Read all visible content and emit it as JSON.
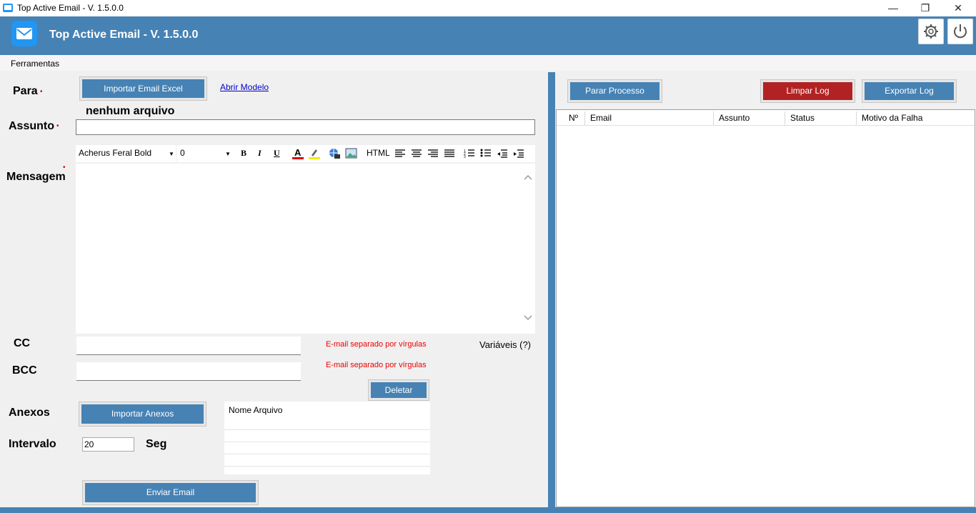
{
  "window": {
    "title": "Top Active Email - V. 1.5.0.0",
    "minimize": "—",
    "restore": "❐",
    "close": "✕"
  },
  "header": {
    "title": "Top Active Email - V. 1.5.0.0",
    "settings_icon": "gear-icon",
    "power_icon": "power-icon"
  },
  "menu": {
    "items": [
      "Ferramentas"
    ]
  },
  "form": {
    "para_label": "Para",
    "import_excel": "Importar Email Excel",
    "open_model": "Abrir Modelo",
    "no_file": "nenhum arquivo",
    "assunto_label": "Assunto",
    "assunto_value": "",
    "mensagem_label": "Mensagem",
    "cc_label": "CC",
    "bcc_label": "BCC",
    "cc_hint": "E-mail separado por vírgulas",
    "bcc_hint": "E-mail separado por vírgulas",
    "variaveis": "Variáveis (?)",
    "delete": "Deletar",
    "anexos_label": "Anexos",
    "import_anexos": "Importar Anexos",
    "attach_header": "Nome Arquivo",
    "intervalo_label": "Intervalo",
    "intervalo_value": "20",
    "seg_label": "Seg",
    "send": "Enviar Email",
    "required_mark": "•"
  },
  "toolbar": {
    "font": "Acherus Feral Bold",
    "size": "0",
    "bold": "B",
    "italic": "I",
    "underline": "U",
    "html": "HTML"
  },
  "log": {
    "stop": "Parar Processo",
    "clear": "Limpar Log",
    "export": "Exportar Log",
    "columns": [
      "Nº",
      "Email",
      "Assunto",
      "Status",
      "Motivo da Falha"
    ]
  },
  "colors": {
    "primary": "#4682b4",
    "danger": "#b22222",
    "hint": "#e00000"
  }
}
